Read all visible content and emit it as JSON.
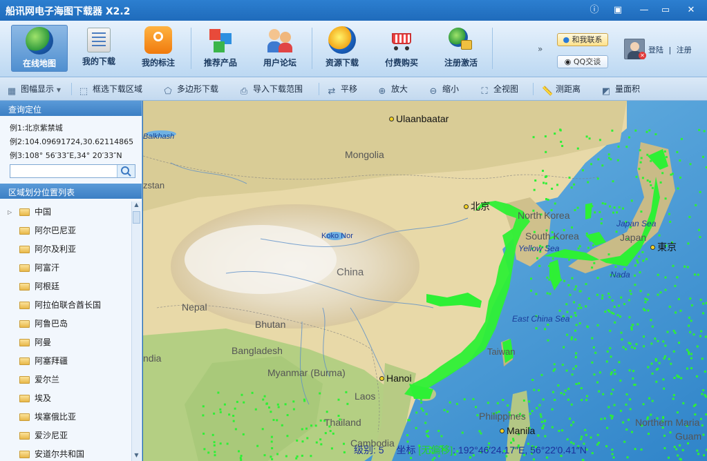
{
  "window": {
    "title": "船讯网电子海图下载器 X2.2"
  },
  "main_toolbar": {
    "buttons": [
      {
        "label": "在线地图"
      },
      {
        "label": "我的下载"
      },
      {
        "label": "我的标注"
      },
      {
        "label": "推荐产品"
      },
      {
        "label": "用户论坛"
      },
      {
        "label": "资源下载"
      },
      {
        "label": "付费购买"
      },
      {
        "label": "注册激活"
      }
    ],
    "contact_label": "和我联系",
    "qq_label": "QQ交谈",
    "login_label": "登陆",
    "separator": "|",
    "logout_label": "注册"
  },
  "sub_toolbar": {
    "items": [
      {
        "label": "图幅显示"
      },
      {
        "label": "框选下载区域"
      },
      {
        "label": "多边形下载"
      },
      {
        "label": "导入下载范围"
      },
      {
        "label": "平移"
      },
      {
        "label": "放大"
      },
      {
        "label": "缩小"
      },
      {
        "label": "全视图"
      },
      {
        "label": "测距离"
      },
      {
        "label": "量面积"
      }
    ]
  },
  "search_panel": {
    "header": "查询定位",
    "examples": [
      "例1:北京紫禁城",
      "例2:104.09691724,30.62114865",
      "例3:108° 56′33″E,34° 20′33″N"
    ],
    "input_value": ""
  },
  "region_panel": {
    "header": "区域划分位置列表",
    "items": [
      "中国",
      "阿尔巴尼亚",
      "阿尔及利亚",
      "阿富汗",
      "阿根廷",
      "阿拉伯联合酋长国",
      "阿鲁巴岛",
      "阿曼",
      "阿塞拜疆",
      "爱尔兰",
      "埃及",
      "埃塞俄比亚",
      "爱沙尼亚",
      "安道尔共和国"
    ]
  },
  "map": {
    "labels": {
      "ulaanbaatar": "Ulaanbaatar",
      "mongolia": "Mongolia",
      "balkhash": "Balkhash",
      "kazakhstan": "zstan",
      "koko_nor": "Koko Nor",
      "china": "China",
      "beijing": "北京",
      "north_korea": "North Korea",
      "south_korea": "South Korea",
      "japan": "Japan",
      "japan_sea": "Japan Sea",
      "yellow_sea": "Yellow Sea",
      "tokyo": "東京",
      "nada": "Nada",
      "east_china_sea": "East China Sea",
      "nepal": "Nepal",
      "bhutan": "Bhutan",
      "india": "ndia",
      "bangladesh": "Bangladesh",
      "myanmar": "Myanmar (Burma)",
      "hanoi": "Hanoi",
      "laos": "Laos",
      "thailand": "Thailand",
      "cambodia": "Cambodia",
      "philippines": "Philippines",
      "manila": "Manila",
      "taiwan": "Taiwan",
      "northern_mariana": "Northern Maria",
      "guam": "Guam"
    },
    "status": {
      "level_label": "级别:",
      "level_value": "5",
      "coord_label": "坐标",
      "coord_tag": "[无偏移]",
      "coord_value": ": 192°46′24.17″E, 56°22′0.41″N"
    }
  }
}
